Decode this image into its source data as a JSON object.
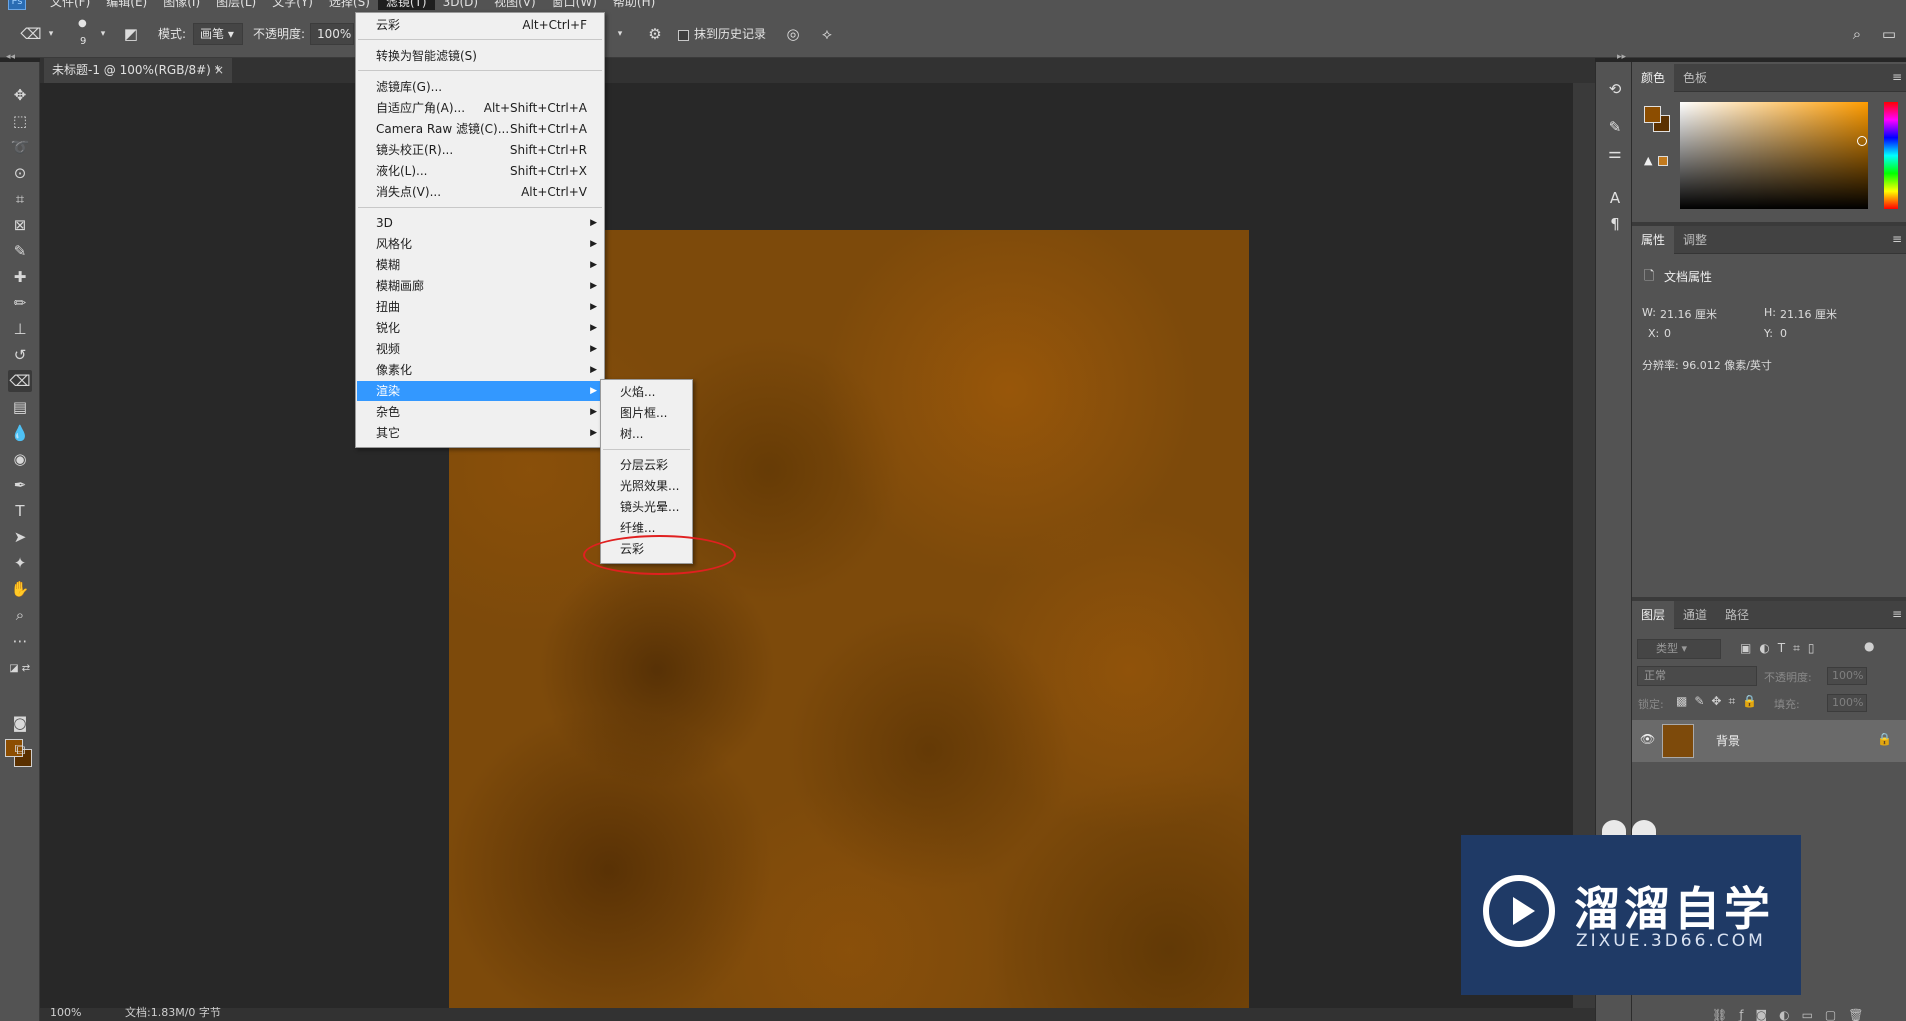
{
  "menubar": {
    "items": [
      "文件(F)",
      "编辑(E)",
      "图像(I)",
      "图层(L)",
      "文字(Y)",
      "选择(S)",
      "滤镜(T)",
      "3D(D)",
      "视图(V)",
      "窗口(W)",
      "帮助(H)"
    ],
    "active_index": 6
  },
  "options": {
    "brush_size": "9",
    "mode_label": "模式:",
    "mode_value": "画笔",
    "opacity_label": "不透明度:",
    "opacity_value": "100%",
    "erase_history_label": "抹到历史记录"
  },
  "document": {
    "tab_title": "未标题-1 @ 100%(RGB/8#) *",
    "close": "×"
  },
  "status": {
    "zoom": "100%",
    "doc_info": "文档:1.83M/0 字节"
  },
  "filter_menu": {
    "items": [
      {
        "label": "云彩",
        "shortcut": "Alt+Ctrl+F"
      },
      {
        "label": "转换为智能滤镜(S)",
        "shortcut": ""
      },
      {
        "label": "滤镜库(G)...",
        "shortcut": ""
      },
      {
        "label": "自适应广角(A)...",
        "shortcut": "Alt+Shift+Ctrl+A"
      },
      {
        "label": "Camera Raw 滤镜(C)...",
        "shortcut": "Shift+Ctrl+A"
      },
      {
        "label": "镜头校正(R)...",
        "shortcut": "Shift+Ctrl+R"
      },
      {
        "label": "液化(L)...",
        "shortcut": "Shift+Ctrl+X"
      },
      {
        "label": "消失点(V)...",
        "shortcut": "Alt+Ctrl+V"
      },
      {
        "label": "3D",
        "shortcut": ""
      },
      {
        "label": "风格化",
        "shortcut": ""
      },
      {
        "label": "模糊",
        "shortcut": ""
      },
      {
        "label": "模糊画廊",
        "shortcut": ""
      },
      {
        "label": "扭曲",
        "shortcut": ""
      },
      {
        "label": "锐化",
        "shortcut": ""
      },
      {
        "label": "视频",
        "shortcut": ""
      },
      {
        "label": "像素化",
        "shortcut": ""
      },
      {
        "label": "渲染",
        "shortcut": ""
      },
      {
        "label": "杂色",
        "shortcut": ""
      },
      {
        "label": "其它",
        "shortcut": ""
      }
    ],
    "highlighted": "渲染"
  },
  "render_submenu": {
    "items": [
      "火焰...",
      "图片框...",
      "树...",
      "分层云彩",
      "光照效果...",
      "镜头光晕...",
      "纤维...",
      "云彩"
    ],
    "annotated": "云彩"
  },
  "color_panel": {
    "tabs": [
      "颜色",
      "色板"
    ],
    "foreground": "#8c4d00",
    "background": "#5a3000"
  },
  "properties_panel": {
    "tabs": [
      "属性",
      "调整"
    ],
    "section": "文档属性",
    "w_label": "W:",
    "w_value": "21.16 厘米",
    "h_label": "H:",
    "h_value": "21.16 厘米",
    "x_label": "X:",
    "x_value": "0",
    "y_label": "Y:",
    "y_value": "0",
    "resolution": "分辨率: 96.012 像素/英寸"
  },
  "layers_panel": {
    "tabs": [
      "图层",
      "通道",
      "路径"
    ],
    "search_placeholder": "类型",
    "blend_mode": "正常",
    "opacity_label": "不透明度:",
    "opacity_value": "100%",
    "lock_label": "锁定:",
    "fill_label": "填充:",
    "fill_value": "100%",
    "layers": [
      {
        "name": "背景",
        "locked": true,
        "visible": true
      }
    ]
  },
  "watermark": {
    "brand": "溜溜自学",
    "url": "ZIXUE.3D66.COM"
  }
}
